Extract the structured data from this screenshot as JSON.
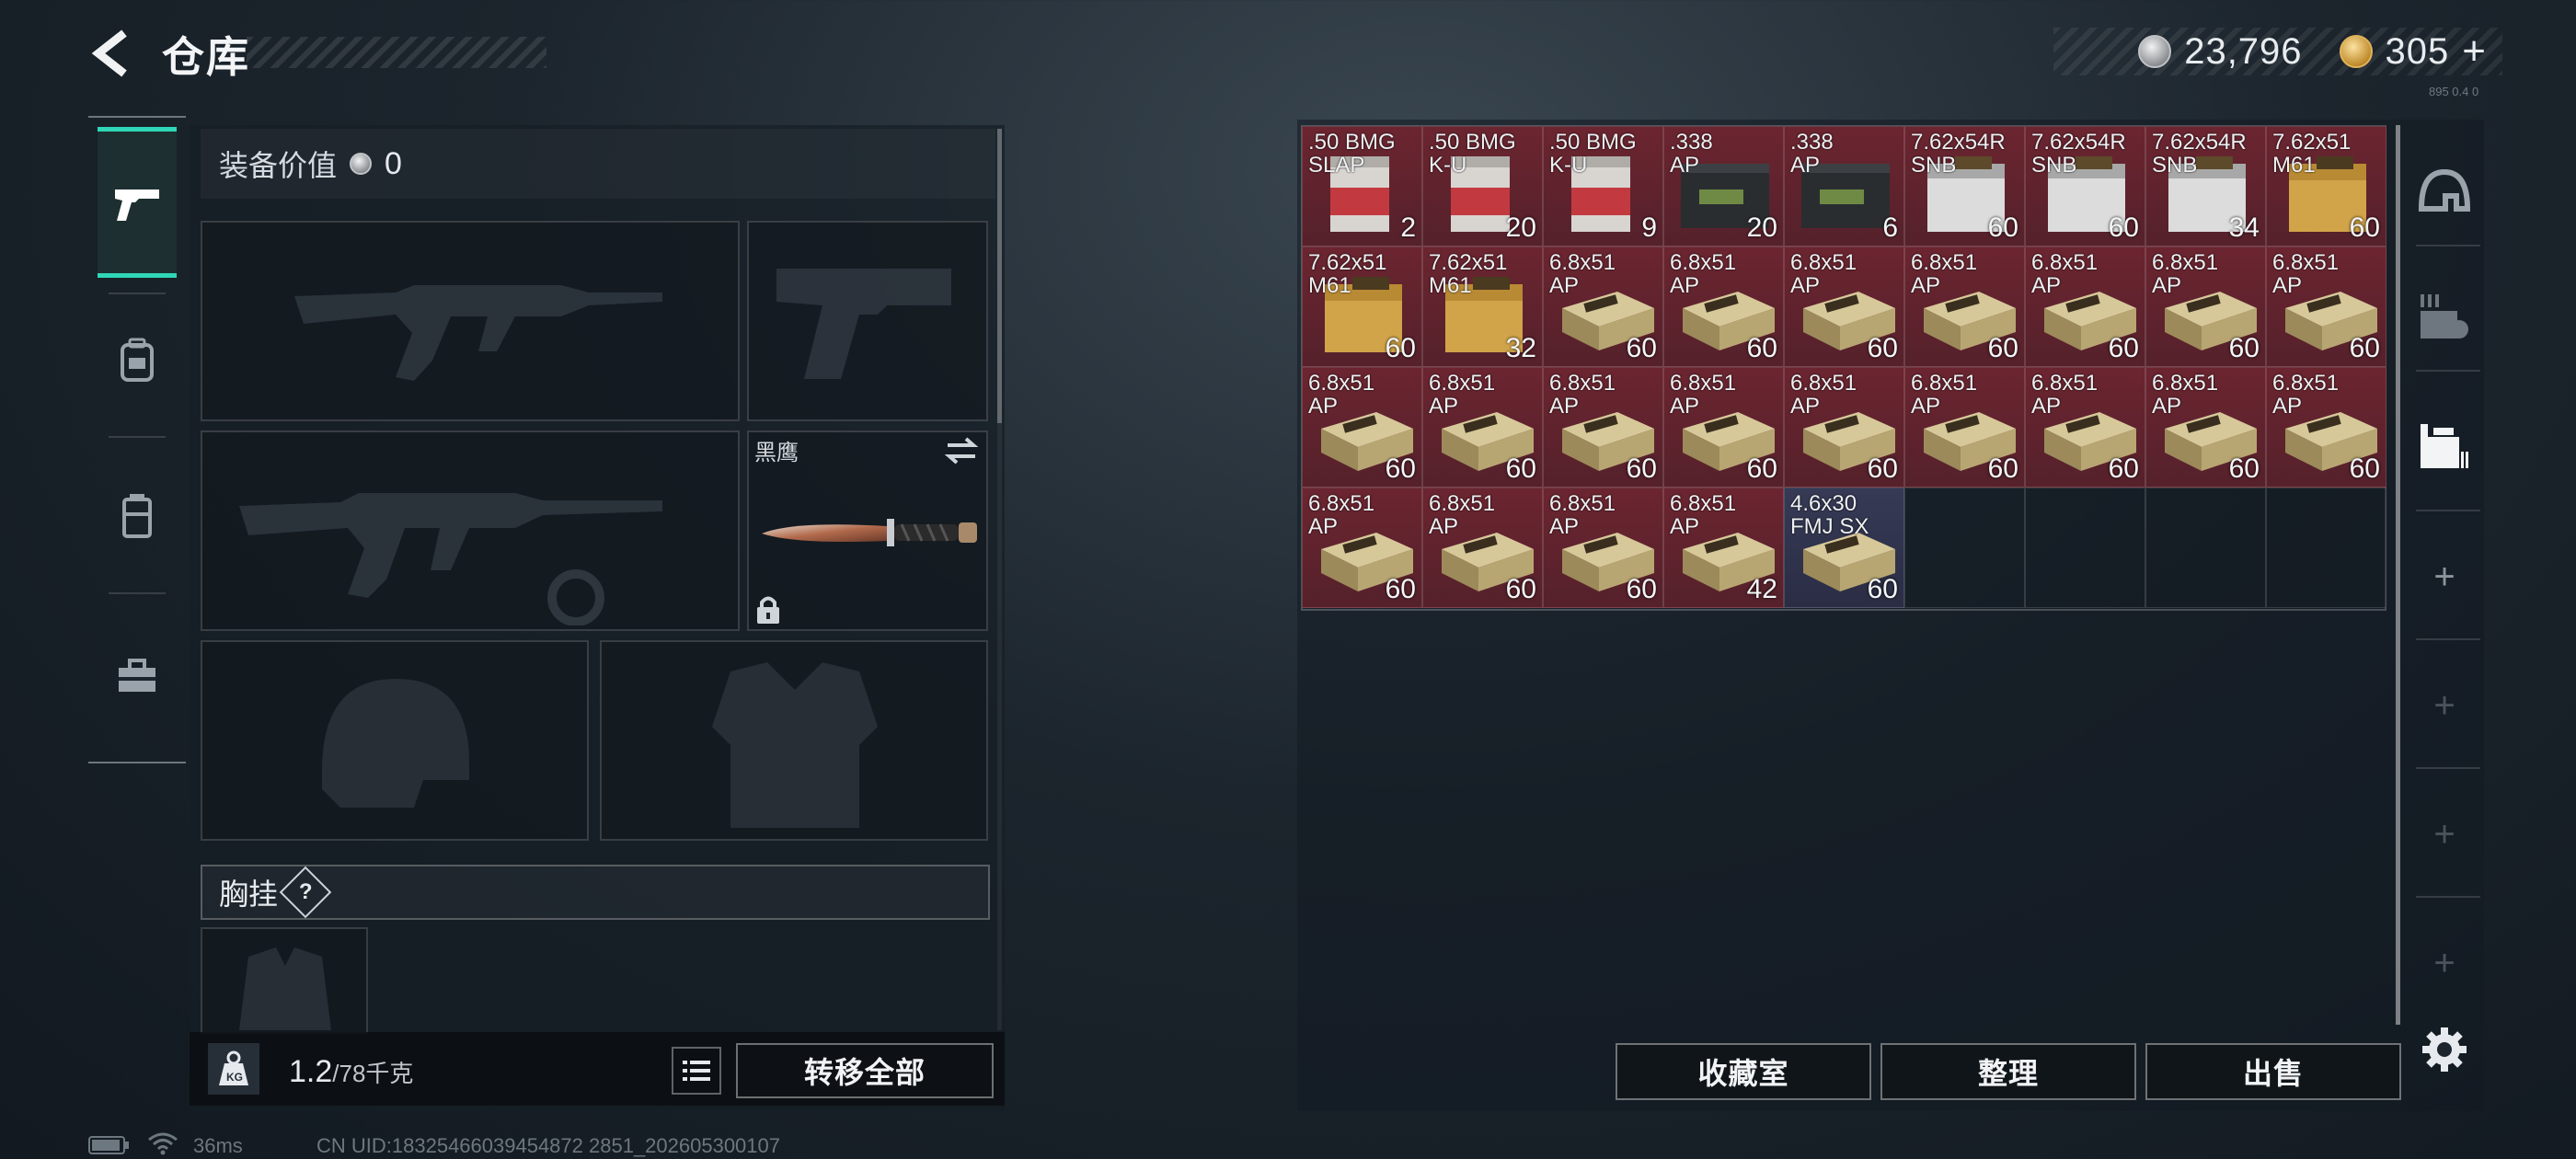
{
  "header": {
    "title": "仓库",
    "silver_amount": "23,796",
    "gold_amount": "305",
    "gold_plus": "+",
    "ping_small": "895 0.4 0"
  },
  "left_nav": {
    "items": [
      {
        "name": "weapons",
        "icon": "pistol-icon",
        "active": true
      },
      {
        "name": "backpack",
        "icon": "backpack-icon",
        "active": false
      },
      {
        "name": "vest",
        "icon": "vest-icon",
        "active": false
      },
      {
        "name": "toolbox",
        "icon": "toolbox-icon",
        "active": false
      }
    ]
  },
  "equipment": {
    "value_label": "装备价值",
    "value": "0",
    "knife_label": "黑鹰",
    "chest_label": "胸挂",
    "help": "?",
    "weight_current": "1.2",
    "weight_max": "/78千克",
    "transfer_all": "转移全部"
  },
  "storage": {
    "items": [
      {
        "name": ".50 BMG\nSLAP",
        "qty": "2",
        "rarity": "red",
        "art": "ammo-red"
      },
      {
        "name": ".50 BMG\nK-U",
        "qty": "20",
        "rarity": "red",
        "art": "ammo-red"
      },
      {
        "name": ".50 BMG\nK-U",
        "qty": "9",
        "rarity": "red",
        "art": "ammo-red"
      },
      {
        "name": ".338\nAP",
        "qty": "20",
        "rarity": "red",
        "art": "ammo-dark"
      },
      {
        "name": ".338\nAP",
        "qty": "6",
        "rarity": "red",
        "art": "ammo-dark"
      },
      {
        "name": "7.62x54R\nSNB",
        "qty": "60",
        "rarity": "red",
        "art": "ammo-white"
      },
      {
        "name": "7.62x54R\nSNB",
        "qty": "60",
        "rarity": "red",
        "art": "ammo-white"
      },
      {
        "name": "7.62x54R\nSNB",
        "qty": "34",
        "rarity": "red",
        "art": "ammo-white"
      },
      {
        "name": "7.62x51\nM61",
        "qty": "60",
        "rarity": "red",
        "art": "ammo-orange"
      },
      {
        "name": "7.62x51\nM61",
        "qty": "60",
        "rarity": "red",
        "art": "ammo-orange"
      },
      {
        "name": "7.62x51\nM61",
        "qty": "32",
        "rarity": "red",
        "art": "ammo-orange"
      },
      {
        "name": "6.8x51\nAP",
        "qty": "60",
        "rarity": "red",
        "art": "ammo-box"
      },
      {
        "name": "6.8x51\nAP",
        "qty": "60",
        "rarity": "red",
        "art": "ammo-box"
      },
      {
        "name": "6.8x51\nAP",
        "qty": "60",
        "rarity": "red",
        "art": "ammo-box"
      },
      {
        "name": "6.8x51\nAP",
        "qty": "60",
        "rarity": "red",
        "art": "ammo-box"
      },
      {
        "name": "6.8x51\nAP",
        "qty": "60",
        "rarity": "red",
        "art": "ammo-box"
      },
      {
        "name": "6.8x51\nAP",
        "qty": "60",
        "rarity": "red",
        "art": "ammo-box"
      },
      {
        "name": "6.8x51\nAP",
        "qty": "60",
        "rarity": "red",
        "art": "ammo-box"
      },
      {
        "name": "6.8x51\nAP",
        "qty": "60",
        "rarity": "red",
        "art": "ammo-box"
      },
      {
        "name": "6.8x51\nAP",
        "qty": "60",
        "rarity": "red",
        "art": "ammo-box"
      },
      {
        "name": "6.8x51\nAP",
        "qty": "60",
        "rarity": "red",
        "art": "ammo-box"
      },
      {
        "name": "6.8x51\nAP",
        "qty": "60",
        "rarity": "red",
        "art": "ammo-box"
      },
      {
        "name": "6.8x51\nAP",
        "qty": "60",
        "rarity": "red",
        "art": "ammo-box"
      },
      {
        "name": "6.8x51\nAP",
        "qty": "60",
        "rarity": "red",
        "art": "ammo-box"
      },
      {
        "name": "6.8x51\nAP",
        "qty": "60",
        "rarity": "red",
        "art": "ammo-box"
      },
      {
        "name": "6.8x51\nAP",
        "qty": "60",
        "rarity": "red",
        "art": "ammo-box"
      },
      {
        "name": "6.8x51\nAP",
        "qty": "60",
        "rarity": "red",
        "art": "ammo-box"
      },
      {
        "name": "6.8x51\nAP",
        "qty": "60",
        "rarity": "red",
        "art": "ammo-box"
      },
      {
        "name": "6.8x51\nAP",
        "qty": "60",
        "rarity": "red",
        "art": "ammo-box"
      },
      {
        "name": "6.8x51\nAP",
        "qty": "60",
        "rarity": "red",
        "art": "ammo-box"
      },
      {
        "name": "6.8x51\nAP",
        "qty": "42",
        "rarity": "red",
        "art": "ammo-box"
      },
      {
        "name": "4.6x30\nFMJ SX",
        "qty": "60",
        "rarity": "blue",
        "art": "ammo-box"
      }
    ],
    "empty_cells": 4,
    "buttons": {
      "collection": "收藏室",
      "sort": "整理",
      "sell": "出售"
    }
  },
  "right_tools": [
    {
      "icon": "helmet-icon"
    },
    {
      "icon": "weapon-rack-icon"
    },
    {
      "icon": "storage-shelf-icon"
    }
  ],
  "footer": {
    "ping": "36ms",
    "uid": "CN UID:18325466039454872 2851_202605300107"
  },
  "colors": {
    "accent": "#2fd7b8",
    "rarity_red": "#5e2330",
    "rarity_blue": "#30344d"
  }
}
